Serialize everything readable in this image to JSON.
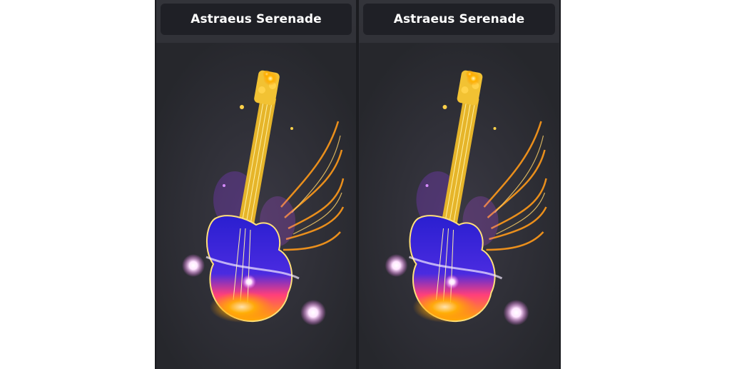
{
  "panels": [
    {
      "title": "Astraeus Serenade",
      "image": {
        "icon": "glowing-guitar-icon",
        "accent": "#f5c542",
        "body_top": "#3a2bd8",
        "body_bottom": "#ff8a00"
      }
    },
    {
      "title": "Astraeus Serenade",
      "image": {
        "icon": "glowing-guitar-icon",
        "accent": "#f5c542",
        "body_top": "#3a2bd8",
        "body_bottom": "#ff8a00"
      }
    }
  ]
}
